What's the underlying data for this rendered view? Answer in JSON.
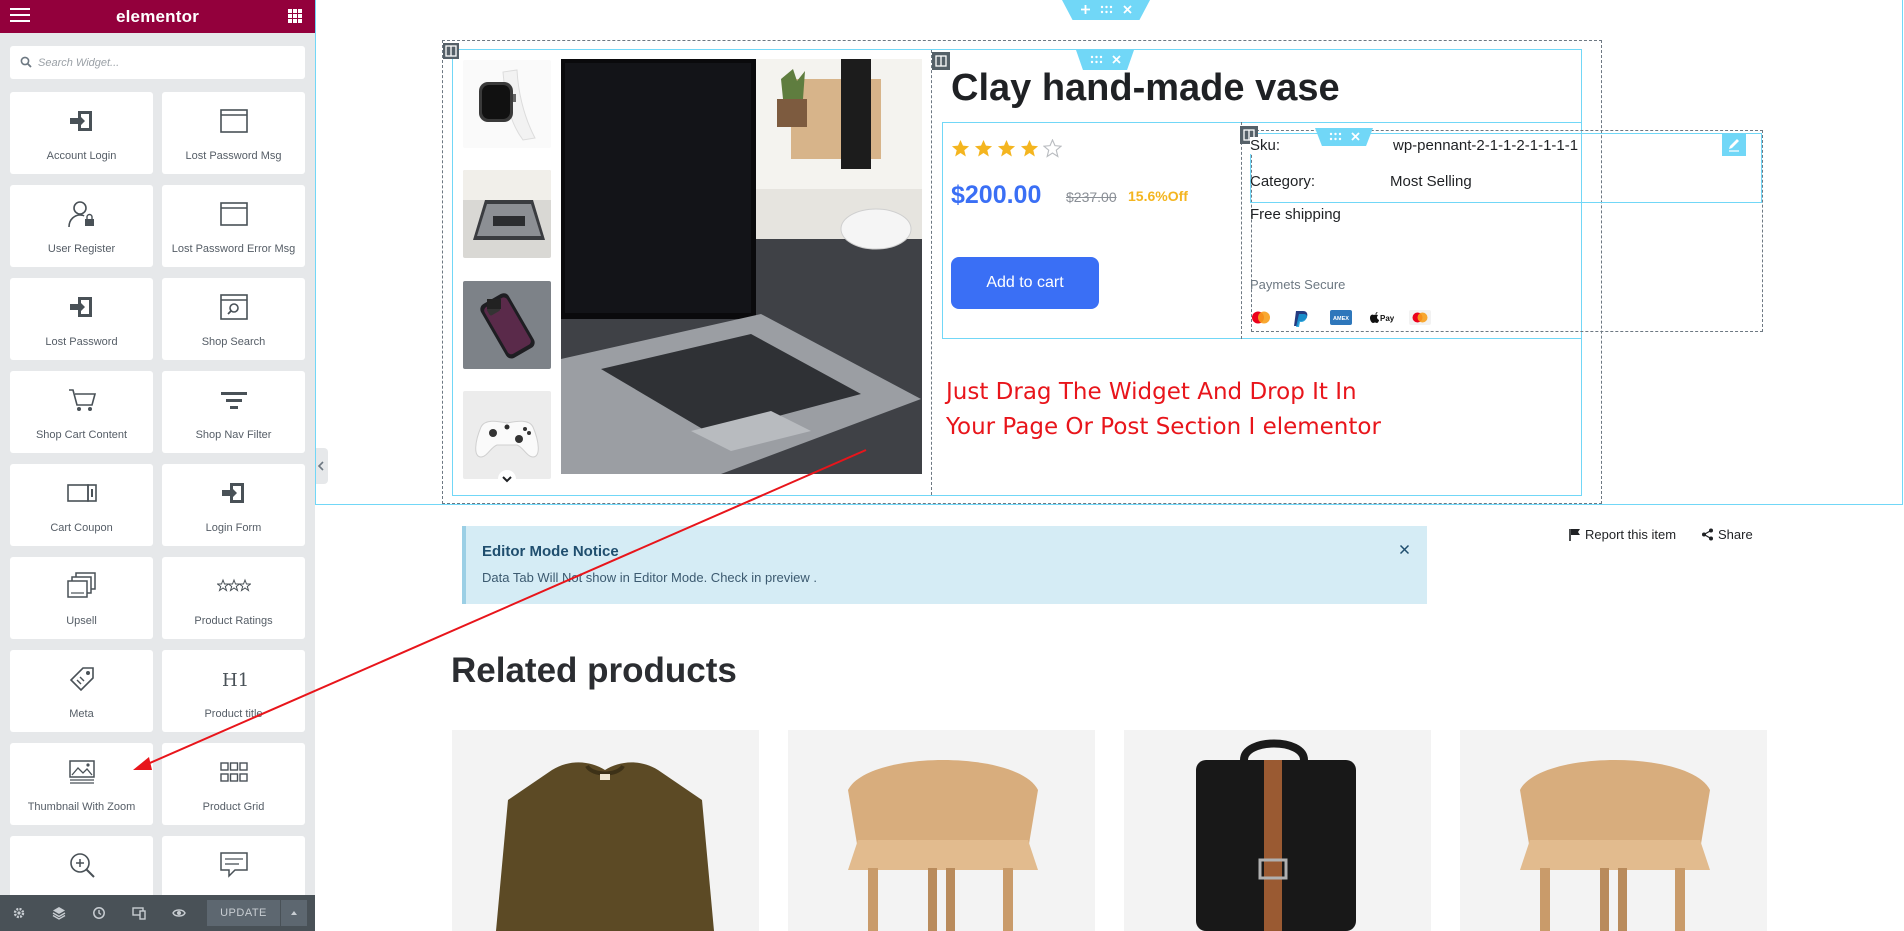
{
  "sidebar": {
    "logo": "elementor",
    "search_placeholder": "Search Widget...",
    "widgets": [
      {
        "label": "Account Login",
        "icon": "sign-in-icon"
      },
      {
        "label": "Lost Password Msg",
        "icon": "window-icon"
      },
      {
        "label": "User Register",
        "icon": "user-lock-icon"
      },
      {
        "label": "Lost Password Error Msg",
        "icon": "window-icon"
      },
      {
        "label": "Lost Password",
        "icon": "sign-in-icon"
      },
      {
        "label": "Shop Search",
        "icon": "search-window-icon"
      },
      {
        "label": "Shop Cart Content",
        "icon": "cart-icon"
      },
      {
        "label": "Shop Nav Filter",
        "icon": "filter-icon"
      },
      {
        "label": "Cart Coupon",
        "icon": "coupon-icon"
      },
      {
        "label": "Login Form",
        "icon": "sign-in-icon"
      },
      {
        "label": "Upsell",
        "icon": "gallery-icon"
      },
      {
        "label": "Product Ratings",
        "icon": "stars-icon"
      },
      {
        "label": "Meta",
        "icon": "tag-icon"
      },
      {
        "label": "Product title",
        "icon": "heading-icon"
      },
      {
        "label": "Thumbnail With Zoom",
        "icon": "image-icon"
      },
      {
        "label": "Product Grid",
        "icon": "grid-icon"
      },
      {
        "label": "",
        "icon": "zoom-in-icon"
      },
      {
        "label": "",
        "icon": "comment-icon"
      }
    ],
    "update_label": "UPDATE"
  },
  "product": {
    "title": "Clay hand-made vase",
    "rating": 4,
    "rating_max": 5,
    "price": "$200.00",
    "old_price": "$237.00",
    "discount": "15.6%Off",
    "add_to_cart": "Add to cart",
    "sku_label": "Sku:",
    "sku_value": "wp-pennant-2-1-1-2-1-1-1-1",
    "category_label": "Category:",
    "category_value": "Most Selling",
    "shipping": "Free shipping",
    "payments_label": "Paymets Secure",
    "payment_methods": [
      "mastercard-icon",
      "paypal-icon",
      "amex-icon",
      "apple-pay-icon",
      "maestro-icon"
    ],
    "apple_pay_text": "Pay",
    "amex_text": "AMEX"
  },
  "annotation": {
    "line1": "Just Drag The Widget And Drop It In",
    "line2": "Your Page Or Post Section I elementor"
  },
  "notice": {
    "title": "Editor Mode Notice",
    "body": "Data Tab Will Not show in Editor Mode. Check in preview ."
  },
  "links": {
    "report": "Report this item",
    "share": "Share"
  },
  "related": {
    "heading": "Related products",
    "items": [
      "sweater-image",
      "chair-image",
      "backpack-image",
      "chair-image"
    ]
  },
  "colors": {
    "brand": "#93003c",
    "accent": "#3a6ff5",
    "discount": "#f4b51f",
    "annotation": "#e8151b",
    "handle": "#71d7f7"
  }
}
